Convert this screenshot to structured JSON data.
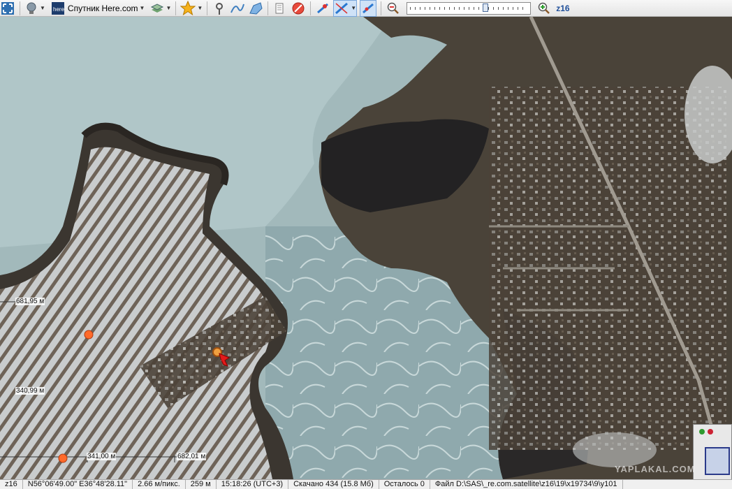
{
  "toolbar": {
    "map_source_label": "Спутник Here.com",
    "zoom_label": "z16",
    "zoom_level_fraction": 0.64,
    "icons": [
      "fullscreen-icon",
      "globe-icon",
      "here-logo-icon",
      "layers-icon",
      "favorites-star-icon",
      "place-mark-icon",
      "path-icon",
      "polygon-icon",
      "markers-list-icon",
      "no-entry-icon",
      "gps-icon",
      "gps-track-icon",
      "gps-center-icon",
      "zoom-out-icon",
      "zoom-in-icon"
    ]
  },
  "map": {
    "ruler_labels": {
      "vertical_1": "681,95 м",
      "vertical_2": "340,99 м",
      "horizontal_1": "341,00 м",
      "horizontal_2": "682,01 м"
    },
    "watermark": "YAPLAKAL.COM"
  },
  "statusbar": {
    "zoom": "z16",
    "coords": "N56°06'49.00\" E36°48'28.11\"",
    "resolution": "2.66 м/пикс.",
    "altitude": "259 м",
    "time": "15:18:26 (UTC+3)",
    "downloaded": "Скачано 434 (15.8 Мб)",
    "remaining": "Осталось 0",
    "file": "Файл D:\\SAS\\_re.com.satellite\\z16\\19\\x19734\\9\\y101"
  },
  "colors": {
    "ice": "#9fb7b9",
    "land": "#4a4339",
    "snow": "#d9dcdc",
    "marker": "#ff6a2a"
  }
}
